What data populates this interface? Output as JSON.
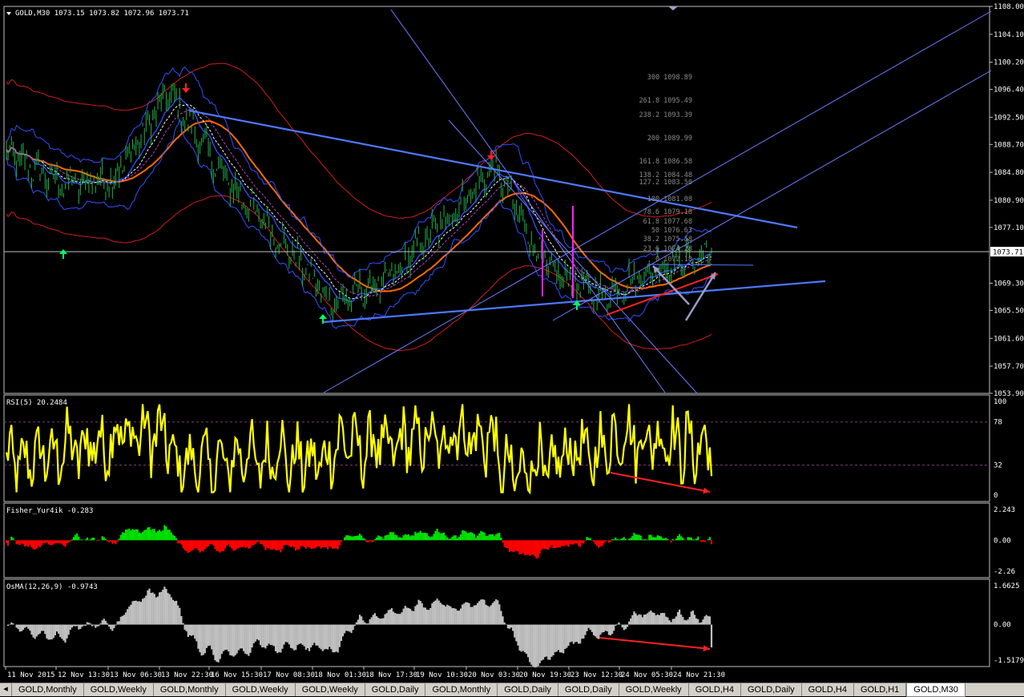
{
  "window": {
    "title": "GOLD,M30",
    "ohlc": "1073.15 1073.82 1072.96 1073.71",
    "current_price": "1073.71"
  },
  "colors": {
    "candle": "#22b24c",
    "bollinger": "#3250ff",
    "envelope": "#d21e1e",
    "ma_orange": "#ff6a00",
    "trendline": "#4e78ff",
    "channel": "#6c7cff",
    "rsi": "#ffff00",
    "fisher_pos": "#00e000",
    "fisher_neg": "#ff0000",
    "osma": "#c0c0c0",
    "annot_red": "#ff2020",
    "annot_gray": "#9a9ac8",
    "magenta": "#ff20ff",
    "axis_text": "#ffffff",
    "fib_text": "#8a8a8a"
  },
  "price_axis_labels": [
    "1108.00",
    "1104.10",
    "1100.20",
    "1096.40",
    "1092.50",
    "1088.70",
    "1084.80",
    "1080.90",
    "1077.10",
    "1069.30",
    "1065.50",
    "1061.60",
    "1057.70",
    "1053.90"
  ],
  "time_axis_labels": [
    "11 Nov 2015",
    "12 Nov 13:30",
    "13 Nov 06:30",
    "13 Nov 22:30",
    "16 Nov 15:30",
    "17 Nov 08:30",
    "18 Nov 01:30",
    "18 Nov 17:30",
    "19 Nov 10:30",
    "20 Nov 03:30",
    "20 Nov 19:30",
    "23 Nov 12:30",
    "24 Nov 05:30",
    "24 Nov 21:30"
  ],
  "fib_labels": [
    "300 1098.89",
    "261.8 1095.49",
    "238.2 1093.39",
    "200 1089.99",
    "161.8 1086.58",
    "138.2 1084.48",
    "127.2 1083.50",
    "100 1081.08",
    "78.6 1079.18",
    "61.8 1077.68",
    "50 1076.63",
    "38.2 1075.58",
    "23.6 1074.28",
    "0 1072.18"
  ],
  "tabs": [
    "GOLD,Monthly",
    "GOLD,Weekly",
    "GOLD,Monthly",
    "GOLD,Weekly",
    "GOLD,Weekly",
    "GOLD,Daily",
    "GOLD,Monthly",
    "GOLD,Daily",
    "GOLD,Daily",
    "GOLD,Weekly",
    "GOLD,H4",
    "GOLD,Daily",
    "GOLD,H4",
    "GOLD,H1",
    "GOLD,M30"
  ],
  "chart_data": [
    {
      "type": "line",
      "name": "GOLD,M30",
      "ylim": [
        1053.9,
        1108.0
      ],
      "series": [
        {
          "name": "GOLD,M30",
          "x": [
            "11 Nov 2015",
            "12 Nov 13:30",
            "13 Nov 06:30",
            "13 Nov 22:30",
            "16 Nov 15:30",
            "17 Nov 08:30",
            "18 Nov 01:30",
            "18 Nov 17:30",
            "19 Nov 10:30",
            "20 Nov 03:30",
            "20 Nov 19:30",
            "23 Nov 12:30",
            "24 Nov 05:30",
            "24 Nov 21:30"
          ],
          "values": [
            1087.5,
            1083.0,
            1084.0,
            1096.0,
            1084.0,
            1076.0,
            1066.5,
            1069.5,
            1077.5,
            1085.5,
            1071.0,
            1067.5,
            1071.5,
            1073.71
          ]
        }
      ]
    },
    {
      "type": "line",
      "name": "RSI(5) 20.2484",
      "ylim": [
        0,
        100
      ],
      "yticks": [
        "100",
        "78",
        "32",
        "0"
      ],
      "series": [
        {
          "name": "RSI(5)",
          "last": 20.2484
        }
      ]
    },
    {
      "type": "bar",
      "name": "Fisher_Yur4ik -0.283",
      "ylim": [
        -2.26,
        2.243
      ],
      "yticks": [
        "2.243",
        "0.00",
        "-2.26"
      ],
      "series": [
        {
          "name": "Fisher_Yur4ik",
          "last": -0.283
        }
      ]
    },
    {
      "type": "bar",
      "name": "OsMA(12,26,9) -0.9743",
      "ylim": [
        -1.5179,
        1.6625
      ],
      "yticks": [
        "1.6625",
        "0.00",
        "-1.5179"
      ],
      "series": [
        {
          "name": "OsMA(12,26,9)",
          "last": -0.9743
        }
      ]
    }
  ]
}
